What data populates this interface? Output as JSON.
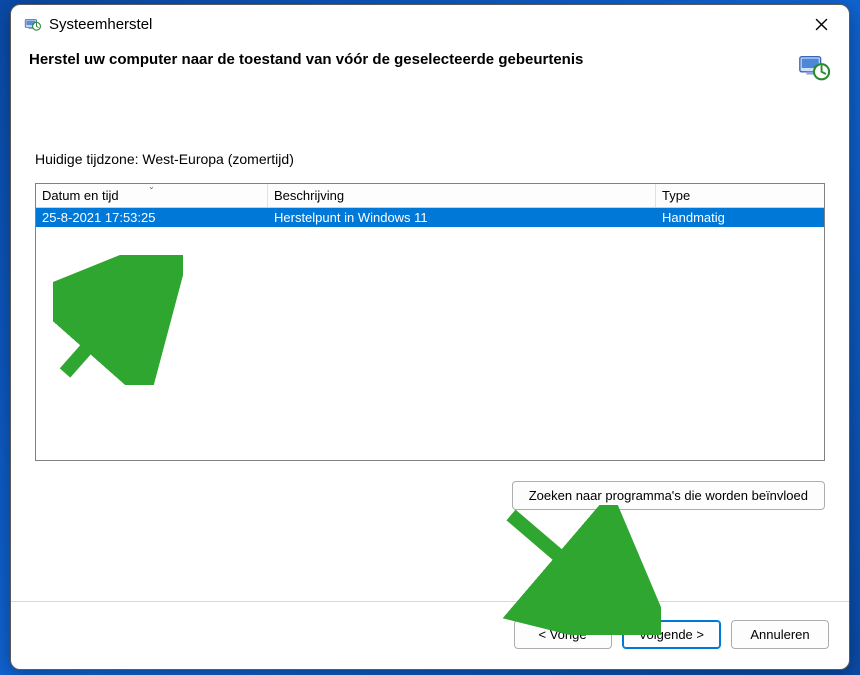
{
  "window": {
    "title": "Systeemherstel",
    "heading": "Herstel uw computer naar de toestand van vóór de geselecteerde gebeurtenis",
    "timezone_label": "Huidige tijdzone: West-Europa (zomertijd)"
  },
  "table": {
    "columns": {
      "date": "Datum en tijd",
      "description": "Beschrijving",
      "type": "Type"
    },
    "sort_column": "date",
    "sort_dir": "desc",
    "rows": [
      {
        "date": "25-8-2021 17:53:25",
        "description": "Herstelpunt in Windows 11",
        "type": "Handmatig",
        "selected": true
      }
    ]
  },
  "buttons": {
    "scan_affected": "Zoeken naar programma's die worden beïnvloed",
    "back": "< Vorige",
    "next": "Volgende >",
    "cancel": "Annuleren"
  },
  "icons": {
    "title_icon": "system-restore-icon",
    "heading_icon": "system-restore-clock-icon",
    "close": "close-icon"
  },
  "colors": {
    "selection": "#0078d7",
    "arrow": "#2fa62f"
  }
}
